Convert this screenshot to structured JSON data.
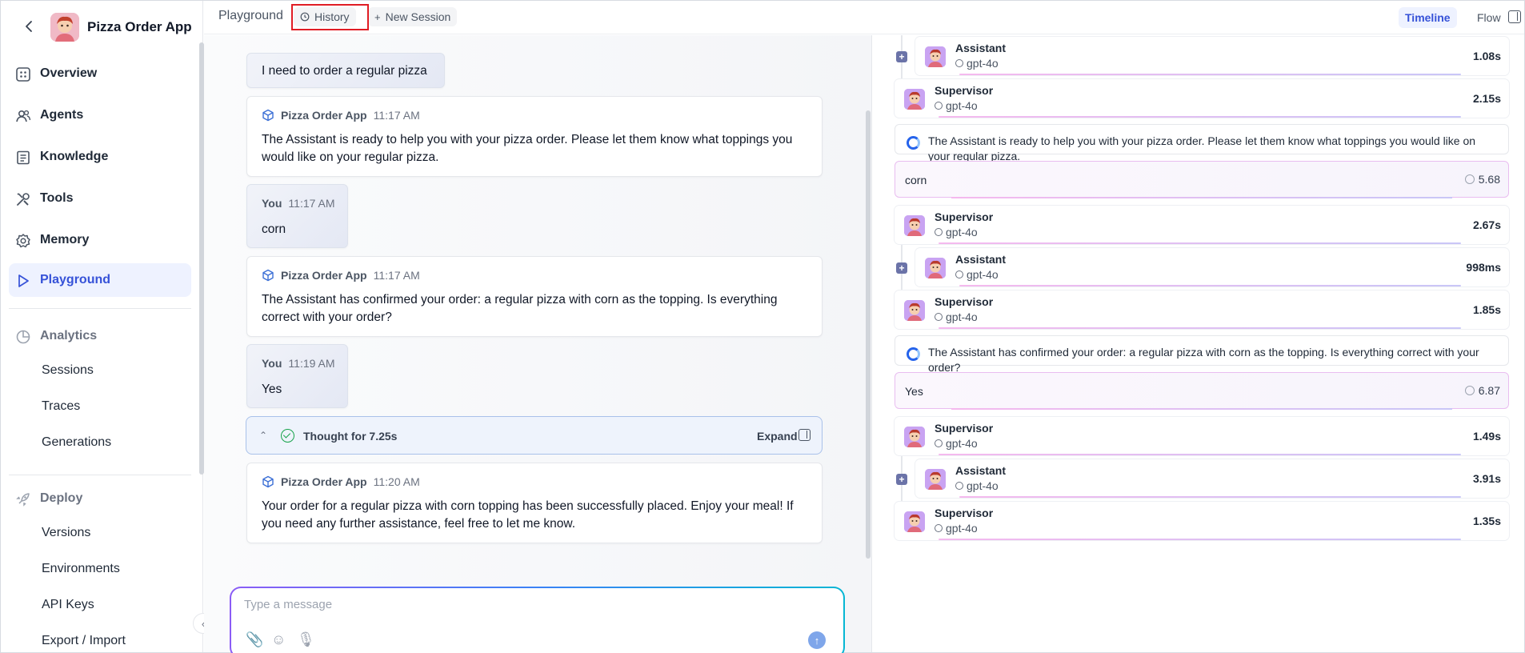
{
  "app": {
    "name": "Pizza Order App"
  },
  "sidebar": {
    "nav": [
      {
        "label": "Overview",
        "icon": "grid-icon"
      },
      {
        "label": "Agents",
        "icon": "users-icon"
      },
      {
        "label": "Knowledge",
        "icon": "book-icon"
      },
      {
        "label": "Tools",
        "icon": "tools-icon"
      },
      {
        "label": "Memory",
        "icon": "gear-icon"
      },
      {
        "label": "Playground",
        "icon": "play-icon",
        "active": true
      }
    ],
    "analytics": {
      "label": "Analytics",
      "items": [
        "Sessions",
        "Traces",
        "Generations"
      ]
    },
    "deploy": {
      "label": "Deploy",
      "items": [
        "Versions",
        "Environments",
        "API Keys",
        "Export / Import"
      ]
    }
  },
  "topbar": {
    "title": "Playground",
    "history_label": "History",
    "new_session_label": "New Session",
    "timeline_label": "Timeline",
    "flow_label": "Flow"
  },
  "chat": {
    "messages": [
      {
        "role": "user",
        "text": "I need to order a regular pizza"
      },
      {
        "role": "app",
        "sender": "Pizza Order App",
        "time": "11:17 AM",
        "text": "The Assistant is ready to help you with your pizza order. Please let them know what toppings you would like on your regular pizza."
      },
      {
        "role": "user",
        "sender": "You",
        "time": "11:17 AM",
        "text": "corn"
      },
      {
        "role": "app",
        "sender": "Pizza Order App",
        "time": "11:17 AM",
        "text": "The Assistant has confirmed your order: a regular pizza with corn as the topping. Is everything correct with your order?"
      },
      {
        "role": "user",
        "sender": "You",
        "time": "11:19 AM",
        "text": "Yes"
      },
      {
        "role": "app",
        "sender": "Pizza Order App",
        "time": "11:20 AM",
        "text": "Your order for a regular pizza with corn topping has been successfully placed. Enjoy your meal! If you need any further assistance, feel free to let me know."
      }
    ],
    "thought": {
      "label": "Thought for 7.25s",
      "expand_label": "Expand"
    },
    "composer": {
      "placeholder": "Type a message"
    }
  },
  "timeline": {
    "items": [
      {
        "type": "agent",
        "name": "Assistant",
        "model": "gpt-4o",
        "duration": "1.08s",
        "nested": true
      },
      {
        "type": "agent",
        "name": "Supervisor",
        "model": "gpt-4o",
        "duration": "2.15s"
      },
      {
        "type": "message",
        "text": "The Assistant is ready to help you with your pizza order. Please let them know what toppings you would like on your regular pizza."
      },
      {
        "type": "user",
        "text": "corn",
        "time": "5.68"
      },
      {
        "type": "agent",
        "name": "Supervisor",
        "model": "gpt-4o",
        "duration": "2.67s"
      },
      {
        "type": "agent",
        "name": "Assistant",
        "model": "gpt-4o",
        "duration": "998ms",
        "nested": true
      },
      {
        "type": "agent",
        "name": "Supervisor",
        "model": "gpt-4o",
        "duration": "1.85s"
      },
      {
        "type": "message",
        "text": "The Assistant has confirmed your order: a regular pizza with corn as the topping. Is everything correct with your order?"
      },
      {
        "type": "user",
        "text": "Yes",
        "time": "6.87"
      },
      {
        "type": "agent",
        "name": "Supervisor",
        "model": "gpt-4o",
        "duration": "1.49s"
      },
      {
        "type": "agent",
        "name": "Assistant",
        "model": "gpt-4o",
        "duration": "3.91s",
        "nested": true
      },
      {
        "type": "agent",
        "name": "Supervisor",
        "model": "gpt-4o",
        "duration": "1.35s"
      }
    ]
  },
  "colors": {
    "accent": "#3652d8",
    "highlight": "#e01c24",
    "thought_border": "#a9c1ea",
    "user_border": "#e9bdf0"
  }
}
